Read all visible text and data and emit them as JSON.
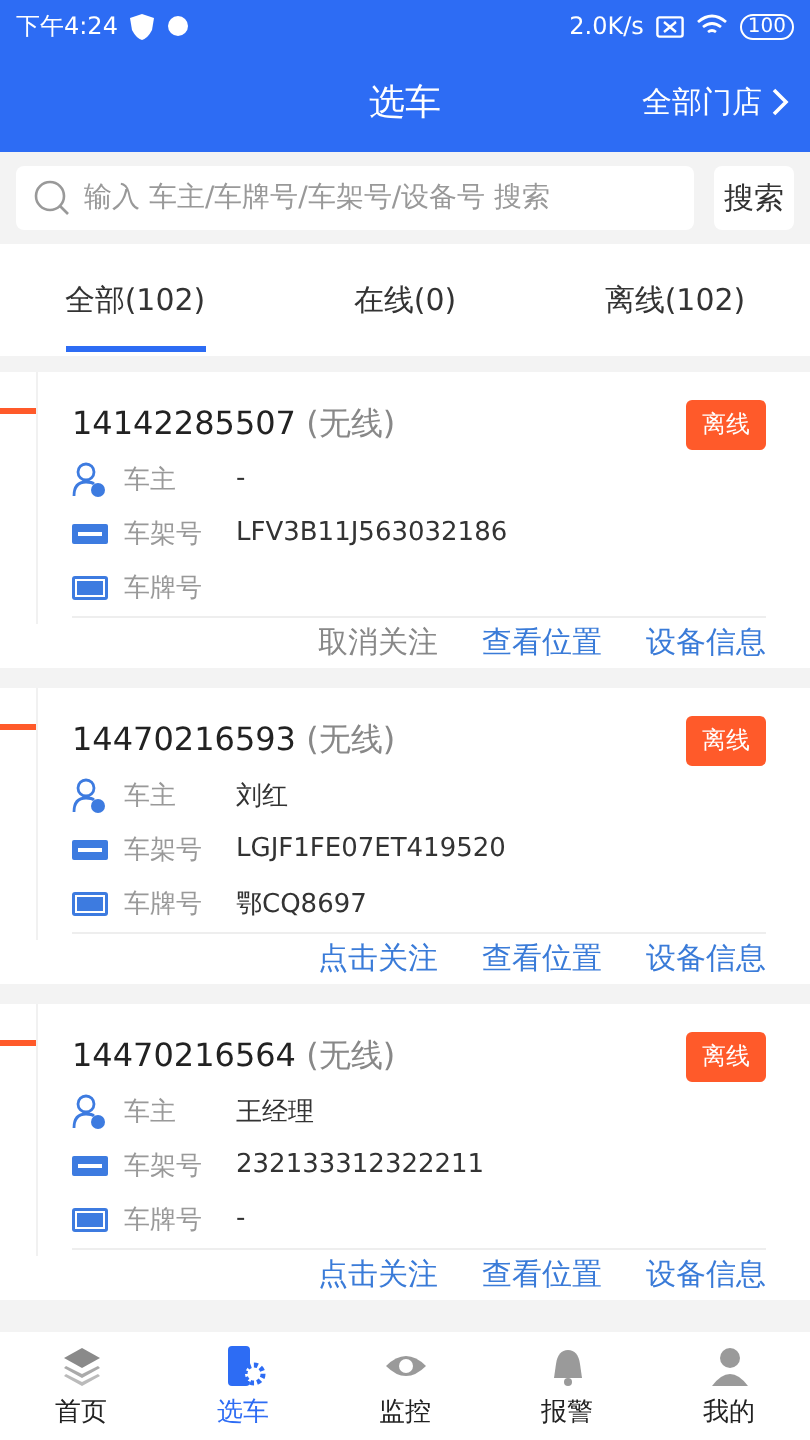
{
  "status_bar": {
    "time": "下午4:24",
    "speed": "2.0K/s",
    "battery": "100"
  },
  "header": {
    "title": "选车",
    "store_filter": "全部门店"
  },
  "search": {
    "placeholder": "输入 车主/车牌号/车架号/设备号 搜索",
    "button": "搜索"
  },
  "tabs": [
    {
      "label": "全部(102)",
      "selected": true
    },
    {
      "label": "在线(0)",
      "selected": false
    },
    {
      "label": "离线(102)",
      "selected": false
    }
  ],
  "vehicles": [
    {
      "device": "14142285507",
      "mode": "(无线)",
      "status": "离线",
      "owner_label": "车主",
      "owner": "-",
      "vin_label": "车架号",
      "vin": "LFV3B11J563032186",
      "plate_label": "车牌号",
      "follow": "取消关注",
      "followed": true,
      "locate": "查看位置",
      "info": "设备信息"
    },
    {
      "device": "14470216593",
      "mode": "(无线)",
      "status": "离线",
      "owner_label": "车主",
      "owner": "刘红",
      "vin_label": "车架号",
      "vin": "LGJF1FE07ET419520",
      "plate_label": "车牌号",
      "plate": "鄂CQ8697",
      "follow": "点击关注",
      "followed": false,
      "locate": "查看位置",
      "info": "设备信息"
    },
    {
      "device": "14470216564",
      "mode": "(无线)",
      "status": "离线",
      "owner_label": "车主",
      "owner": "王经理",
      "vin_label": "车架号",
      "vin": "232133312322211",
      "plate_label": "车牌号",
      "plate": "-",
      "follow": "点击关注",
      "followed": false,
      "locate": "查看位置",
      "info": "设备信息"
    }
  ],
  "bottom_nav": [
    {
      "label": "首页",
      "selected": false
    },
    {
      "label": "选车",
      "selected": true
    },
    {
      "label": "监控",
      "selected": false
    },
    {
      "label": "报警",
      "selected": false
    },
    {
      "label": "我的",
      "selected": false
    }
  ]
}
